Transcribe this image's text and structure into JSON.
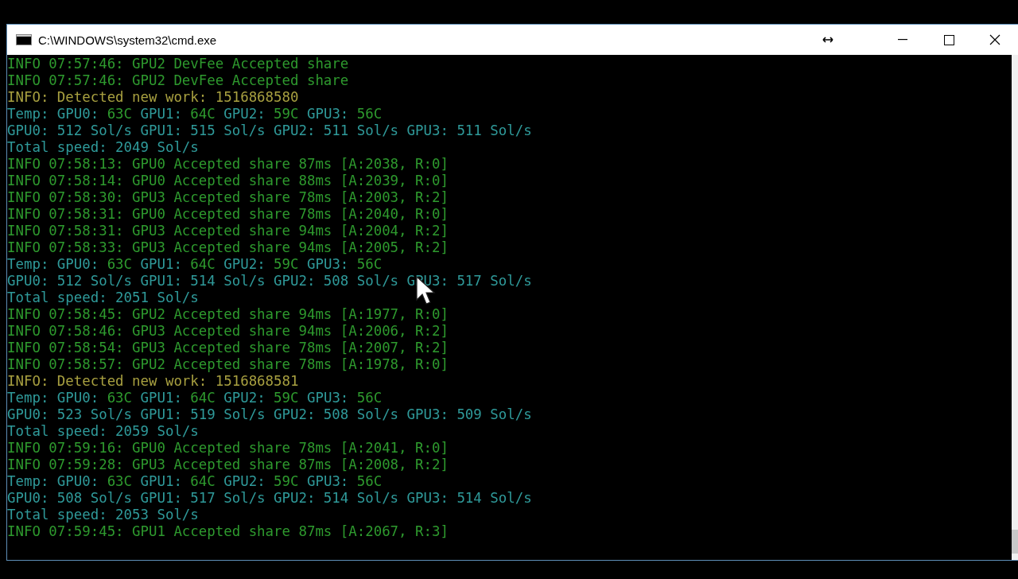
{
  "window": {
    "title": "C:\\WINDOWS\\system32\\cmd.exe"
  },
  "console": {
    "lines": [
      {
        "segments": [
          {
            "text": "INFO 07:57:46: GPU2 DevFee Accepted share",
            "kind": "info"
          }
        ]
      },
      {
        "segments": [
          {
            "text": "INFO 07:57:46: GPU2 DevFee Accepted share",
            "kind": "info"
          }
        ]
      },
      {
        "segments": [
          {
            "text": "INFO: Detected new work: 1516868580",
            "kind": "work"
          }
        ]
      },
      {
        "segments": [
          {
            "text": "Temp: GPU0: ",
            "kind": "label"
          },
          {
            "text": "63C",
            "kind": "info"
          },
          {
            "text": " GPU1: ",
            "kind": "label"
          },
          {
            "text": "64C",
            "kind": "info"
          },
          {
            "text": " GPU2: ",
            "kind": "label"
          },
          {
            "text": "59C",
            "kind": "info"
          },
          {
            "text": " GPU3: ",
            "kind": "label"
          },
          {
            "text": "56C",
            "kind": "info"
          }
        ]
      },
      {
        "segments": [
          {
            "text": "GPU0: 512 Sol/s GPU1: 515 Sol/s GPU2: 511 Sol/s GPU3: 511 Sol/s",
            "kind": "label"
          }
        ]
      },
      {
        "segments": [
          {
            "text": "Total speed: 2049 Sol/s",
            "kind": "label"
          }
        ]
      },
      {
        "segments": [
          {
            "text": "INFO 07:58:13: GPU0 Accepted share 87ms [A:2038, R:0]",
            "kind": "info"
          }
        ]
      },
      {
        "segments": [
          {
            "text": "INFO 07:58:14: GPU0 Accepted share 88ms [A:2039, R:0]",
            "kind": "info"
          }
        ]
      },
      {
        "segments": [
          {
            "text": "INFO 07:58:30: GPU3 Accepted share 78ms [A:2003, R:2]",
            "kind": "info"
          }
        ]
      },
      {
        "segments": [
          {
            "text": "INFO 07:58:31: GPU0 Accepted share 78ms [A:2040, R:0]",
            "kind": "info"
          }
        ]
      },
      {
        "segments": [
          {
            "text": "INFO 07:58:31: GPU3 Accepted share 94ms [A:2004, R:2]",
            "kind": "info"
          }
        ]
      },
      {
        "segments": [
          {
            "text": "INFO 07:58:33: GPU3 Accepted share 94ms [A:2005, R:2]",
            "kind": "info"
          }
        ]
      },
      {
        "segments": [
          {
            "text": "Temp: GPU0: ",
            "kind": "label"
          },
          {
            "text": "63C",
            "kind": "info"
          },
          {
            "text": " GPU1: ",
            "kind": "label"
          },
          {
            "text": "64C",
            "kind": "info"
          },
          {
            "text": " GPU2: ",
            "kind": "label"
          },
          {
            "text": "59C",
            "kind": "info"
          },
          {
            "text": " GPU3: ",
            "kind": "label"
          },
          {
            "text": "56C",
            "kind": "info"
          }
        ]
      },
      {
        "segments": [
          {
            "text": "GPU0: 512 Sol/s GPU1: 514 Sol/s GPU2: 508 Sol/s GPU3: 517 Sol/s",
            "kind": "label"
          }
        ]
      },
      {
        "segments": [
          {
            "text": "Total speed: 2051 Sol/s",
            "kind": "label"
          }
        ]
      },
      {
        "segments": [
          {
            "text": "INFO 07:58:45: GPU2 Accepted share 94ms [A:1977, R:0]",
            "kind": "info"
          }
        ]
      },
      {
        "segments": [
          {
            "text": "INFO 07:58:46: GPU3 Accepted share 94ms [A:2006, R:2]",
            "kind": "info"
          }
        ]
      },
      {
        "segments": [
          {
            "text": "INFO 07:58:54: GPU3 Accepted share 78ms [A:2007, R:2]",
            "kind": "info"
          }
        ]
      },
      {
        "segments": [
          {
            "text": "INFO 07:58:57: GPU2 Accepted share 78ms [A:1978, R:0]",
            "kind": "info"
          }
        ]
      },
      {
        "segments": [
          {
            "text": "INFO: Detected new work: 1516868581",
            "kind": "work"
          }
        ]
      },
      {
        "segments": [
          {
            "text": "Temp: GPU0: ",
            "kind": "label"
          },
          {
            "text": "63C",
            "kind": "info"
          },
          {
            "text": " GPU1: ",
            "kind": "label"
          },
          {
            "text": "64C",
            "kind": "info"
          },
          {
            "text": " GPU2: ",
            "kind": "label"
          },
          {
            "text": "59C",
            "kind": "info"
          },
          {
            "text": " GPU3: ",
            "kind": "label"
          },
          {
            "text": "56C",
            "kind": "info"
          }
        ]
      },
      {
        "segments": [
          {
            "text": "GPU0: 523 Sol/s GPU1: 519 Sol/s GPU2: 508 Sol/s GPU3: 509 Sol/s",
            "kind": "label"
          }
        ]
      },
      {
        "segments": [
          {
            "text": "Total speed: 2059 Sol/s",
            "kind": "label"
          }
        ]
      },
      {
        "segments": [
          {
            "text": "INFO 07:59:16: GPU0 Accepted share 78ms [A:2041, R:0]",
            "kind": "info"
          }
        ]
      },
      {
        "segments": [
          {
            "text": "INFO 07:59:28: GPU3 Accepted share 87ms [A:2008, R:2]",
            "kind": "info"
          }
        ]
      },
      {
        "segments": [
          {
            "text": "Temp: GPU0: ",
            "kind": "label"
          },
          {
            "text": "63C",
            "kind": "info"
          },
          {
            "text": " GPU1: ",
            "kind": "label"
          },
          {
            "text": "64C",
            "kind": "info"
          },
          {
            "text": " GPU2: ",
            "kind": "label"
          },
          {
            "text": "59C",
            "kind": "info"
          },
          {
            "text": " GPU3: ",
            "kind": "label"
          },
          {
            "text": "56C",
            "kind": "info"
          }
        ]
      },
      {
        "segments": [
          {
            "text": "GPU0: 508 Sol/s GPU1: 517 Sol/s GPU2: 514 Sol/s GPU3: 514 Sol/s",
            "kind": "label"
          }
        ]
      },
      {
        "segments": [
          {
            "text": "Total speed: 2053 Sol/s",
            "kind": "label"
          }
        ]
      },
      {
        "segments": [
          {
            "text": "INFO 07:59:45: GPU1 Accepted share 87ms [A:2067, R:3]",
            "kind": "info"
          }
        ]
      }
    ]
  }
}
